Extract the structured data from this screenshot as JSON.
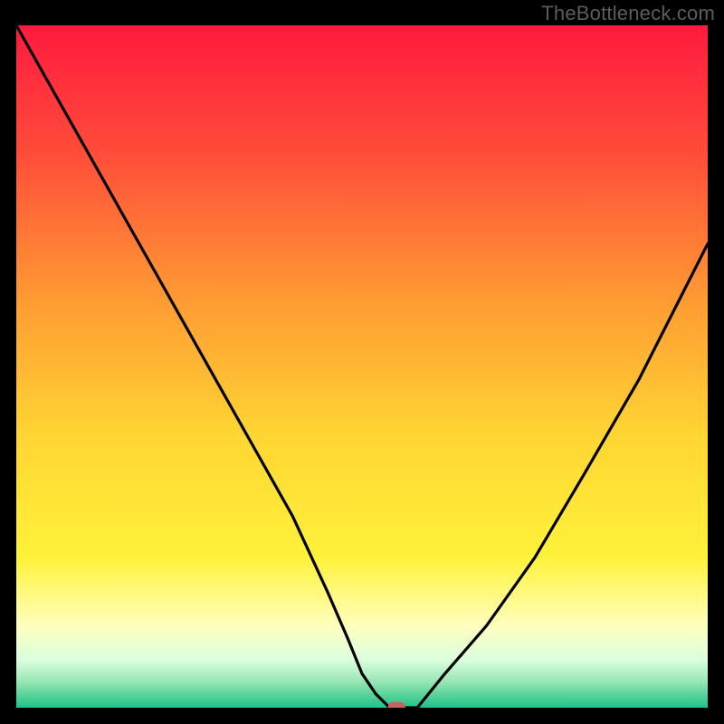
{
  "watermark": "TheBottleneck.com",
  "chart_data": {
    "type": "line",
    "title": "",
    "xlabel": "",
    "ylabel": "",
    "xlim": [
      0,
      100
    ],
    "ylim": [
      0,
      100
    ],
    "grid": false,
    "background": {
      "type": "vertical-gradient",
      "stops": [
        {
          "offset": 0.0,
          "color": "#ff1a3f"
        },
        {
          "offset": 0.18,
          "color": "#ff4a3a"
        },
        {
          "offset": 0.4,
          "color": "#ff9a33"
        },
        {
          "offset": 0.6,
          "color": "#ffd533"
        },
        {
          "offset": 0.78,
          "color": "#fff23a"
        },
        {
          "offset": 0.88,
          "color": "#ffffbe"
        },
        {
          "offset": 0.93,
          "color": "#d9ffde"
        },
        {
          "offset": 0.96,
          "color": "#9de8b7"
        },
        {
          "offset": 0.98,
          "color": "#5cd49b"
        },
        {
          "offset": 1.0,
          "color": "#1cc58b"
        }
      ]
    },
    "series": [
      {
        "name": "bottleneck-curve",
        "color": "#000000",
        "x": [
          0,
          5,
          10,
          15,
          20,
          25,
          30,
          35,
          40,
          45,
          48,
          50,
          52,
          54,
          56,
          58,
          62,
          68,
          75,
          82,
          90,
          100
        ],
        "y": [
          100,
          91,
          82,
          73,
          64,
          55,
          46,
          37,
          28,
          17,
          10,
          5,
          2,
          0,
          0,
          0,
          5,
          12,
          22,
          34,
          48,
          68
        ]
      }
    ],
    "marker": {
      "name": "optimal-point",
      "shape": "rounded-rect",
      "color": "#c9635f",
      "x": 55,
      "y": 0,
      "width_pct": 2.5,
      "height_pct": 1.4
    }
  }
}
